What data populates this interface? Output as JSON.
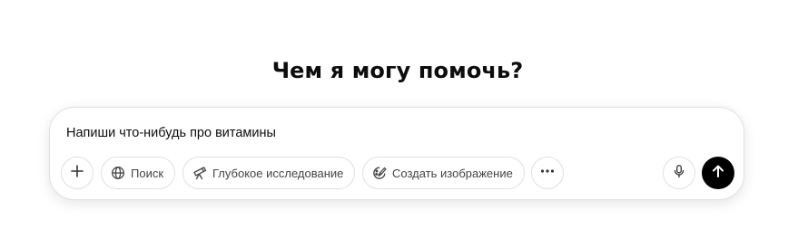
{
  "heading": "Чем я могу помочь?",
  "composer": {
    "input_value": "Напиши что-нибудь про витамины"
  },
  "toolbar": {
    "add_icon": "plus-icon",
    "search_label": "Поиск",
    "deep_research_label": "Глубокое исследование",
    "create_image_label": "Создать изображение",
    "more_icon": "ellipsis-icon",
    "voice_icon": "microphone-icon",
    "send_icon": "arrow-up-icon"
  },
  "colors": {
    "send_button_bg": "#000000",
    "border": "#e0e0e0",
    "text": "#0d0d0d"
  }
}
